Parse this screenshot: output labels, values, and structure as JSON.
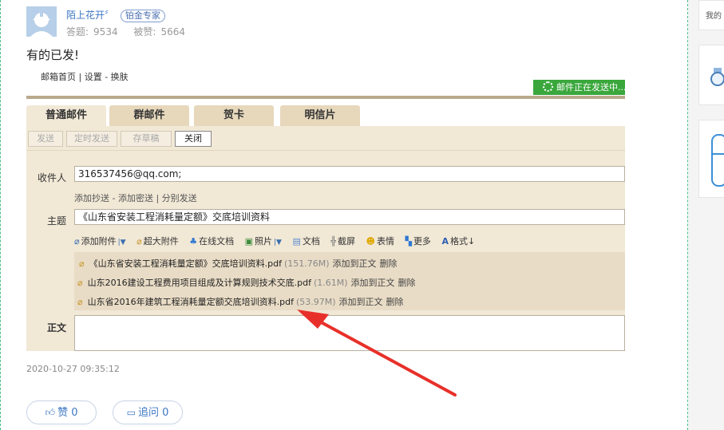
{
  "user": {
    "name": "陌上花开〞",
    "badge": "铂金专家",
    "answers_label": "答题:",
    "answers_value": "9534",
    "likes_label": "被赞:",
    "likes_value": "5664"
  },
  "answer_text": "有的已发!",
  "email": {
    "top_links": "邮箱首页 | 设置 - 换肤",
    "sending_status": "邮件正在发送中...",
    "tabs": [
      {
        "label": "普通邮件"
      },
      {
        "label": "群邮件"
      },
      {
        "label": "贺卡"
      },
      {
        "label": "明信片"
      }
    ],
    "toolbar": {
      "send": "发送",
      "schedule": "定时发送",
      "draft": "存草稿",
      "close": "关闭"
    },
    "recipient_label": "收件人",
    "recipient_value": "316537456@qq.com;",
    "sub_links": "添加抄送 - 添加密送 | 分别发送",
    "subject_label": "主题",
    "subject_value": "《山东省安装工程消耗量定额》交底培训资料",
    "attach_tools": [
      {
        "icon": "paperclip-icon",
        "label": "添加附件",
        "caret": true
      },
      {
        "icon": "paperclip-icon",
        "label": "超大附件",
        "caret": false
      },
      {
        "icon": "online-doc-icon",
        "label": "在线文档",
        "caret": false
      },
      {
        "icon": "photo-icon",
        "label": "照片",
        "caret": true
      },
      {
        "icon": "document-icon",
        "label": "文档",
        "caret": false
      },
      {
        "icon": "screenshot-icon",
        "label": "截屏",
        "caret": false
      },
      {
        "icon": "emoji-icon",
        "label": "表情",
        "caret": false
      },
      {
        "icon": "more-icon",
        "label": "更多",
        "caret": false
      },
      {
        "icon": "format-icon",
        "label": "格式",
        "caret": false
      }
    ],
    "attachments": [
      {
        "name": "《山东省安装工程消耗量定额》交底培训资料.pdf",
        "size": "(151.76M)",
        "add": "添加到正文",
        "delete": "删除"
      },
      {
        "name": "山东2016建设工程费用项目组成及计算规则技术交底.pdf",
        "size": "(1.61M)",
        "add": "添加到正文",
        "delete": "删除"
      },
      {
        "name": "山东省2016年建筑工程消耗量定额交底培训资料.pdf",
        "size": "(53.97M)",
        "add": "添加到正文",
        "delete": "删除"
      }
    ],
    "body_label": "正文"
  },
  "timestamp": "2020-10-27 09:35:12",
  "actions": {
    "like_label": "赞 0",
    "followup_label": "追问 0"
  },
  "sidebar": {
    "top_text": "我的"
  },
  "colors": {
    "accent_blue": "#3c77c4",
    "sending_green": "#3aa73c",
    "compose_bg": "#f1e8d6",
    "arrow_red": "#e8302a"
  }
}
